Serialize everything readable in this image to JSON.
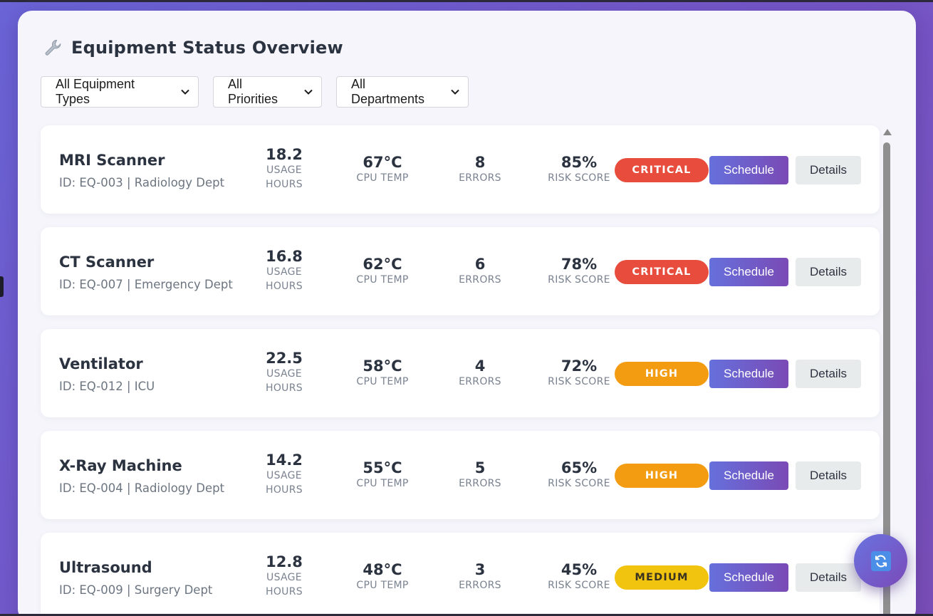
{
  "header": {
    "title": "Equipment Status Overview",
    "icon": "wrench-icon"
  },
  "filters": [
    {
      "selected": "All Equipment Types"
    },
    {
      "selected": "All Priorities"
    },
    {
      "selected": "All Departments"
    }
  ],
  "labels": {
    "usage_line1": "USAGE",
    "usage_line2": "HOURS",
    "cpu_temp": "CPU TEMP",
    "errors": "ERRORS",
    "risk_score": "RISK SCORE",
    "schedule": "Schedule",
    "details": "Details"
  },
  "colors": {
    "critical": "#e74c3c",
    "high": "#f39c12",
    "medium": "#f1c40f",
    "accent_start": "#6670dc",
    "accent_end": "#7a4ab5"
  },
  "equipment": [
    {
      "name": "MRI Scanner",
      "meta": "ID: EQ-003 | Radiology Dept",
      "usage": "18.2",
      "temp": "67°C",
      "errors": "8",
      "risk": "85%",
      "priority": "CRITICAL",
      "priority_color": "#e74c3c"
    },
    {
      "name": "CT Scanner",
      "meta": "ID: EQ-007 | Emergency Dept",
      "usage": "16.8",
      "temp": "62°C",
      "errors": "6",
      "risk": "78%",
      "priority": "CRITICAL",
      "priority_color": "#e74c3c"
    },
    {
      "name": "Ventilator",
      "meta": "ID: EQ-012 | ICU",
      "usage": "22.5",
      "temp": "58°C",
      "errors": "4",
      "risk": "72%",
      "priority": "HIGH",
      "priority_color": "#f39c12"
    },
    {
      "name": "X-Ray Machine",
      "meta": "ID: EQ-004 | Radiology Dept",
      "usage": "14.2",
      "temp": "55°C",
      "errors": "5",
      "risk": "65%",
      "priority": "HIGH",
      "priority_color": "#f39c12"
    },
    {
      "name": "Ultrasound",
      "meta": "ID: EQ-009 | Surgery Dept",
      "usage": "12.8",
      "temp": "48°C",
      "errors": "3",
      "risk": "45%",
      "priority": "MEDIUM",
      "priority_color": "#f1c40f"
    }
  ],
  "fab": {
    "icon": "refresh-icon"
  }
}
